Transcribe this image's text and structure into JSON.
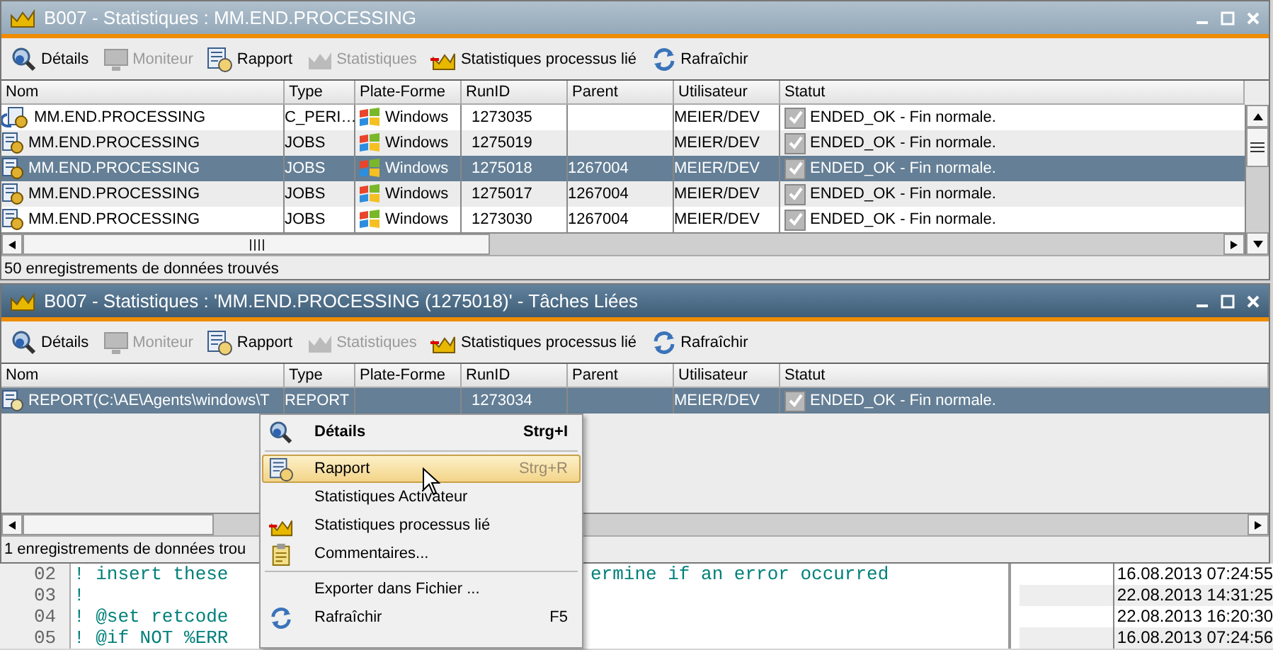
{
  "windows": [
    {
      "title": "B007 - Statistiques : MM.END.PROCESSING",
      "active": false,
      "toolbar": [
        {
          "kind": "details",
          "label": "Détails",
          "disabled": false
        },
        {
          "kind": "monitor",
          "label": "Moniteur",
          "disabled": true
        },
        {
          "kind": "report",
          "label": "Rapport",
          "disabled": false
        },
        {
          "kind": "stats",
          "label": "Statistiques",
          "disabled": true
        },
        {
          "kind": "linked",
          "label": "Statistiques processus lié",
          "disabled": false
        },
        {
          "kind": "refresh",
          "label": "Rafraîchir",
          "disabled": false
        }
      ],
      "columns": [
        "Nom",
        "Type",
        "Plate-Forme",
        "RunID",
        "Parent",
        "Utilisateur",
        "Statut"
      ],
      "rows": [
        {
          "kind": "job-linked",
          "name": "MM.END.PROCESSING",
          "type": "C_PERI…",
          "platform": "Windows",
          "runid": "1273035",
          "user": "MEIER/DEV",
          "status": "ENDED_OK - Fin normale.",
          "checked": true,
          "selected": false
        },
        {
          "kind": "job",
          "name": "MM.END.PROCESSING",
          "type": "JOBS",
          "platform": "Windows",
          "runid": "1275019",
          "user": "MEIER/DEV",
          "status": "ENDED_OK - Fin normale.",
          "checked": true,
          "selected": false
        },
        {
          "kind": "job",
          "name": "MM.END.PROCESSING",
          "type": "JOBS",
          "platform": "Windows",
          "runid": "1275018",
          "parent": "1267004",
          "user": "MEIER/DEV",
          "status": "ENDED_OK - Fin normale.",
          "checked": true,
          "selected": true
        },
        {
          "kind": "job",
          "name": "MM.END.PROCESSING",
          "type": "JOBS",
          "platform": "Windows",
          "runid": "1275017",
          "parent": "1267004",
          "user": "MEIER/DEV",
          "status": "ENDED_OK - Fin normale.",
          "checked": true,
          "selected": false
        },
        {
          "kind": "job",
          "name": "MM.END.PROCESSING",
          "type": "JOBS",
          "platform": "Windows",
          "runid": "1273030",
          "parent": "1267004",
          "user": "MEIER/DEV",
          "status": "ENDED_OK - Fin normale.",
          "checked": true,
          "selected": false
        }
      ],
      "status_bar": "50 enregistrements de données trouvés"
    },
    {
      "title": "B007 - Statistiques : 'MM.END.PROCESSING (1275018)' - Tâches Liées",
      "active": true,
      "toolbar": [
        {
          "kind": "details",
          "label": "Détails",
          "disabled": false
        },
        {
          "kind": "monitor",
          "label": "Moniteur",
          "disabled": true
        },
        {
          "kind": "report",
          "label": "Rapport",
          "disabled": false
        },
        {
          "kind": "stats",
          "label": "Statistiques",
          "disabled": true
        },
        {
          "kind": "linked",
          "label": "Statistiques processus lié",
          "disabled": false
        },
        {
          "kind": "refresh",
          "label": "Rafraîchir",
          "disabled": false
        }
      ],
      "columns": [
        "Nom",
        "Type",
        "Plate-Forme",
        "RunID",
        "Parent",
        "Utilisateur",
        "Statut"
      ],
      "rows": [
        {
          "kind": "report",
          "name": "REPORT(C:\\AE\\Agents\\windows\\T",
          "type": "REPORT",
          "runid": "1273034",
          "user": "MEIER/DEV",
          "status": "ENDED_OK - Fin normale.",
          "checked": true,
          "selected": true
        }
      ],
      "status_bar": "1 enregistrements de données trou"
    }
  ],
  "code_lines": [
    {
      "number": "02",
      "left": "! insert these",
      "right": "ermine if an error occurred"
    },
    {
      "number": "03",
      "left": "!"
    },
    {
      "number": "04",
      "left": "! @set retcode"
    },
    {
      "number": "05",
      "left": "! @if NOT %ERR"
    }
  ],
  "dates": [
    "16.08.2013 07:24:55",
    "22.08.2013 14:31:25",
    "22.08.2013 16:20:30",
    "16.08.2013 07:24:56"
  ],
  "context_menu": [
    [
      {
        "kind": "details",
        "label": "Détails",
        "shortcut": "Strg+I",
        "bold": true,
        "selected": false
      }
    ],
    [
      {
        "kind": "report",
        "label": "Rapport",
        "shortcut": "Strg+R",
        "bold": false,
        "selected": true
      },
      {
        "kind": "none",
        "label": "Statistiques Activateur",
        "bold": false,
        "selected": false
      },
      {
        "kind": "linked",
        "label": "Statistiques processus lié",
        "bold": false,
        "selected": false
      },
      {
        "kind": "comment",
        "label": "Commentaires...",
        "bold": false,
        "selected": false
      }
    ],
    [
      {
        "kind": "none",
        "label": "Exporter dans Fichier ...",
        "bold": false,
        "selected": false
      },
      {
        "kind": "refresh",
        "label": "Rafraîchir",
        "shortcut": "F5",
        "bold": false,
        "selected": false
      }
    ]
  ]
}
